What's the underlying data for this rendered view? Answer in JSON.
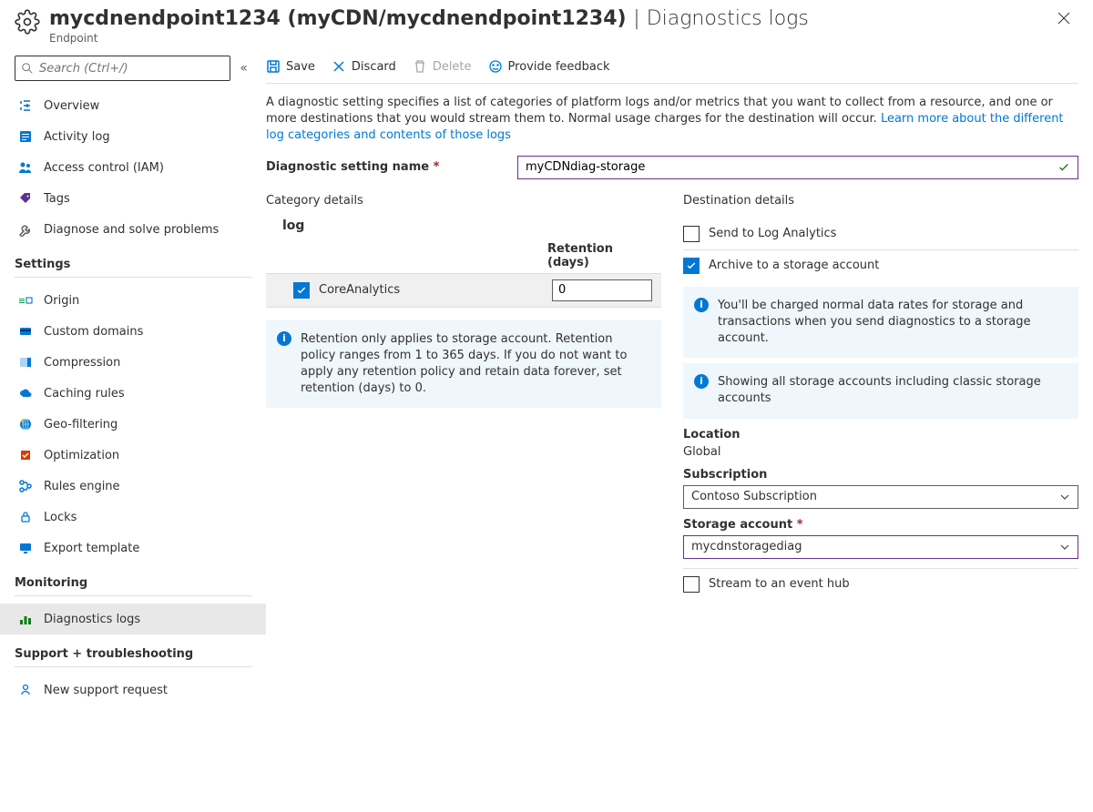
{
  "header": {
    "title_main": "mycdnendpoint1234 (myCDN/mycdnendpoint1234)",
    "title_section": "Diagnostics logs",
    "subtitle": "Endpoint",
    "search_placeholder": "Search (Ctrl+/)"
  },
  "nav": {
    "root": [
      {
        "label": "Overview"
      },
      {
        "label": "Activity log"
      },
      {
        "label": "Access control (IAM)"
      },
      {
        "label": "Tags"
      },
      {
        "label": "Diagnose and solve problems"
      }
    ],
    "sections": {
      "settings": {
        "title": "Settings",
        "items": [
          {
            "label": "Origin"
          },
          {
            "label": "Custom domains"
          },
          {
            "label": "Compression"
          },
          {
            "label": "Caching rules"
          },
          {
            "label": "Geo-filtering"
          },
          {
            "label": "Optimization"
          },
          {
            "label": "Rules engine"
          },
          {
            "label": "Locks"
          },
          {
            "label": "Export template"
          }
        ]
      },
      "monitoring": {
        "title": "Monitoring",
        "items": [
          {
            "label": "Diagnostics logs",
            "selected": true
          }
        ]
      },
      "support": {
        "title": "Support + troubleshooting",
        "items": [
          {
            "label": "New support request"
          }
        ]
      }
    }
  },
  "toolbar": {
    "save": "Save",
    "discard": "Discard",
    "delete": "Delete",
    "feedback": "Provide feedback"
  },
  "desc": {
    "main": "A diagnostic setting specifies a list of categories of platform logs and/or metrics that you want to collect from a resource, and one or more destinations that you would stream them to. Normal usage charges for the destination will occur. ",
    "link": "Learn more about the different log categories and contents of those logs"
  },
  "form": {
    "name_label": "Diagnostic setting name",
    "name_value": "myCDNdiag-storage"
  },
  "category": {
    "title": "Category details",
    "sub": "log",
    "retention_label": "Retention (days)",
    "row": {
      "label": "CoreAnalytics",
      "retention": "0"
    },
    "info": "Retention only applies to storage account. Retention policy ranges from 1 to 365 days. If you do not want to apply any retention policy and retain data forever, set retention (days) to 0."
  },
  "destination": {
    "title": "Destination details",
    "opt_log_analytics": "Send to Log Analytics",
    "opt_storage": "Archive to a storage account",
    "opt_eventhub": "Stream to an event hub",
    "info_storage": "You'll be charged normal data rates for storage and transactions when you send diagnostics to a storage account.",
    "info_accounts": "Showing all storage accounts including classic storage accounts",
    "location_label": "Location",
    "location_value": "Global",
    "subscription_label": "Subscription",
    "subscription_value": "Contoso Subscription",
    "storage_label": "Storage account",
    "storage_value": "mycdnstoragediag"
  }
}
